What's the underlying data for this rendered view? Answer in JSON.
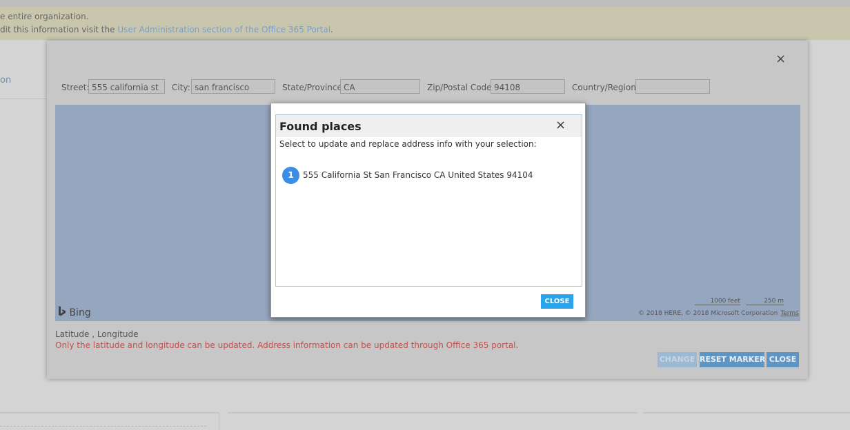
{
  "notice": {
    "line1": "e entire organization.",
    "line2_prefix": "dit this information visit the ",
    "line2_link": "User Administration section of the Office 365 Portal",
    "line2_suffix": "."
  },
  "side_tab": {
    "label": "on"
  },
  "dialog": {
    "close_icon": "×",
    "fields": {
      "street": {
        "label": "Street:",
        "value": "555 california st"
      },
      "city": {
        "label": "City:",
        "value": "san francisco"
      },
      "state": {
        "label": "State/Province:",
        "value": "CA"
      },
      "zip": {
        "label": "Zip/Postal Code:",
        "value": "94108"
      },
      "country": {
        "label": "Country/Region:",
        "value": ""
      }
    },
    "map": {
      "brand": "Bing",
      "brand_icon": "bing-logo-icon",
      "scale_feet": "1000 feet",
      "scale_m": "250 m",
      "copyright": "© 2018 HERE, © 2018 Microsoft Corporation",
      "terms": "Terms"
    },
    "latlon": "Latitude   , Longitude",
    "warning": "Only the latitude and longitude can be updated. Address information can be updated through Office 365 portal.",
    "buttons": {
      "change": "CHANGE",
      "reset": "RESET MARKER",
      "close": "CLOSE"
    },
    "colors": {
      "warning": "#c0504d",
      "button": "#5f95c3"
    }
  },
  "found_places": {
    "title": "Found places",
    "close_icon": "×",
    "subtitle": "Select to update and replace address info with your selection:",
    "results": [
      {
        "number": "1",
        "address": "555 California St San Francisco CA United States 94104"
      }
    ],
    "close_label": "CLOSE",
    "colors": {
      "badge": "#3b8de6",
      "close_button": "#2aa4ea"
    }
  }
}
